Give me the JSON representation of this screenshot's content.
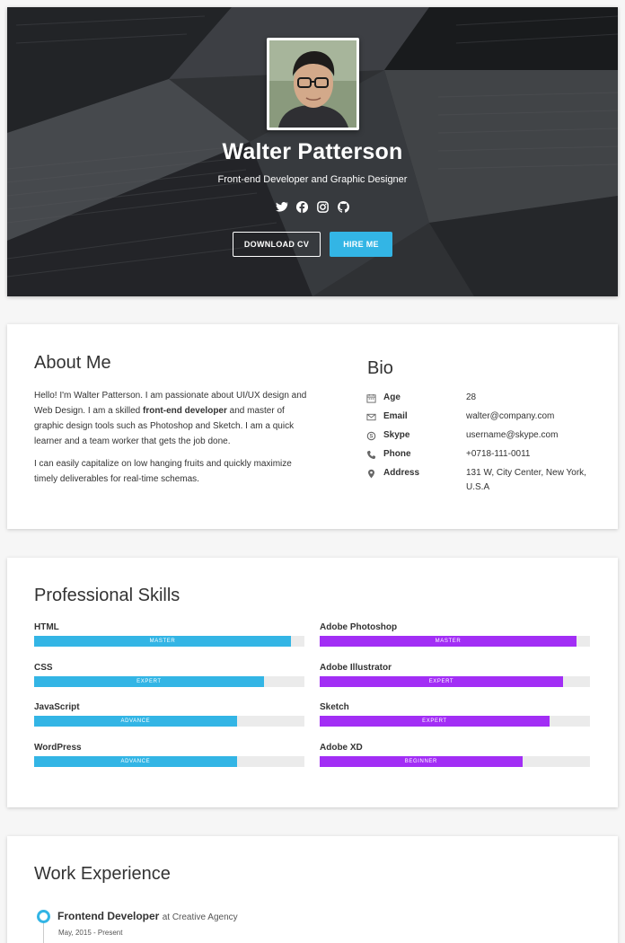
{
  "hero": {
    "name": "Walter Patterson",
    "title": "Front-end Developer and Graphic Designer",
    "social": [
      "twitter-icon",
      "facebook-icon",
      "instagram-icon",
      "github-icon"
    ],
    "download_label": "DOWNLOAD CV",
    "hire_label": "HIRE ME",
    "accent": "#33b5e5"
  },
  "about": {
    "title": "About Me",
    "p1_before": "Hello! I'm Walter Patterson. I am passionate about UI/UX design and Web Design. I am a skilled ",
    "p1_bold": "front-end developer",
    "p1_after": " and master of graphic design tools such as Photoshop and Sketch. I am a quick learner and a team worker that gets the job done.",
    "p2": "I can easily capitalize on low hanging fruits and quickly maximize timely deliverables for real-time schemas."
  },
  "bio": {
    "title": "Bio",
    "rows": [
      {
        "icon": "calendar-icon",
        "label": "Age",
        "value": "28"
      },
      {
        "icon": "envelope-icon",
        "label": "Email",
        "value": "walter@company.com"
      },
      {
        "icon": "skype-icon",
        "label": "Skype",
        "value": "username@skype.com"
      },
      {
        "icon": "phone-icon",
        "label": "Phone",
        "value": "+0718-111-0011"
      },
      {
        "icon": "map-marker-icon",
        "label": "Address",
        "value": "131 W, City Center, New York, U.S.A"
      }
    ]
  },
  "skills": {
    "title": "Professional Skills",
    "left": [
      {
        "name": "HTML",
        "level": "MASTER",
        "percent": 95
      },
      {
        "name": "CSS",
        "level": "EXPERT",
        "percent": 85
      },
      {
        "name": "JavaScript",
        "level": "ADVANCE",
        "percent": 75
      },
      {
        "name": "WordPress",
        "level": "ADVANCE",
        "percent": 75
      }
    ],
    "right": [
      {
        "name": "Adobe Photoshop",
        "level": "MASTER",
        "percent": 95
      },
      {
        "name": "Adobe Illustrator",
        "level": "EXPERT",
        "percent": 90
      },
      {
        "name": "Sketch",
        "level": "EXPERT",
        "percent": 85
      },
      {
        "name": "Adobe XD",
        "level": "BEGINNER",
        "percent": 75
      }
    ],
    "left_color": "#33b5e5",
    "right_color": "#a22ef5"
  },
  "work": {
    "title": "Work Experience",
    "jobs": [
      {
        "title": "Frontend Developer",
        "company": "at Creative Agency",
        "dates": "May, 2015 - Present"
      }
    ]
  }
}
